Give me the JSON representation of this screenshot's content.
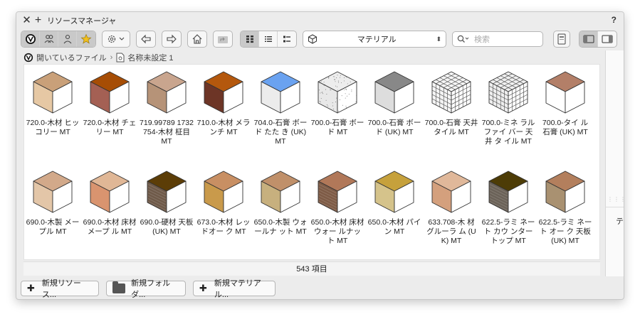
{
  "window": {
    "title": "リソースマネージャ",
    "help": "?"
  },
  "toolbar": {
    "resource_type": "マテリアル",
    "search_placeholder": "検索"
  },
  "path": {
    "root": "開いているファイル",
    "file": "名称未設定 1"
  },
  "items": [
    {
      "label": "720.0-木材 ヒッコリー MT",
      "top": "#c9a079",
      "left": "#e6c8a4",
      "right": "#ffffff",
      "pattern": "none"
    },
    {
      "label": "720.0-木材 チェリー MT",
      "top": "#a64d05",
      "left": "#a46054",
      "right": "#ffffff",
      "pattern": "none"
    },
    {
      "label": "719.99789 1732754-木材 柾目 MT",
      "top": "#c9a58e",
      "left": "#b69378",
      "right": "#ffffff",
      "pattern": "none"
    },
    {
      "label": "710.0-木材 メランチ MT",
      "top": "#b4580d",
      "left": "#6d3526",
      "right": "#ffffff",
      "pattern": "none"
    },
    {
      "label": "704.0-石膏 ボード たた き (UK) MT",
      "top": "#6aa2f0",
      "left": "#ececec",
      "right": "#ffffff",
      "pattern": "none"
    },
    {
      "label": "700.0-石膏 ボード MT",
      "top": "#ededed",
      "left": "#e8e8e8",
      "right": "#ffffff",
      "pattern": "speckle"
    },
    {
      "label": "700.0-石膏 ボード (UK) MT",
      "top": "#888888",
      "left": "#dddddd",
      "right": "#ffffff",
      "pattern": "none"
    },
    {
      "label": "700.0-石膏 天井 タイル MT",
      "top": "#f5f5f5",
      "left": "#f5f5f5",
      "right": "#ffffff",
      "pattern": "grid"
    },
    {
      "label": "700.0-ミネ ラル ファイ バー 天井 タ イル MT",
      "top": "#f0f0f0",
      "left": "#eeeeee",
      "right": "#ffffff",
      "pattern": "grid"
    },
    {
      "label": "700.0-タイ ル 石膏 (UK) MT",
      "top": "#b37f68",
      "left": "#ffffff",
      "right": "#ffffff",
      "pattern": "none"
    },
    {
      "label": "690.0-木製 メープル MT",
      "top": "#d2a98a",
      "left": "#e3c6a8",
      "right": "#ffffff",
      "pattern": "none"
    },
    {
      "label": "690.0-木材 床材 メープ ル MT",
      "top": "#e0b796",
      "left": "#d9946f",
      "right": "#ffffff",
      "pattern": "none"
    },
    {
      "label": "690.0-硬材 天板 (UK) MT",
      "top": "#5c3d07",
      "left": "#6f5a49",
      "right": "#ffffff",
      "pattern": "wood"
    },
    {
      "label": "673.0-木材 レッドオー ク MT",
      "top": "#c88f63",
      "left": "#c99a4b",
      "right": "#ffffff",
      "pattern": "none"
    },
    {
      "label": "650.0-木製 ウォールナ ット MT",
      "top": "#c0906a",
      "left": "#c7b07e",
      "right": "#ffffff",
      "pattern": "none"
    },
    {
      "label": "650.0-木材 床材 ウォー ルナット MT",
      "top": "#b17859",
      "left": "#7e5b46",
      "right": "#ffffff",
      "pattern": "wood"
    },
    {
      "label": "650.0-木材 パイン MT",
      "top": "#c6a13c",
      "left": "#d5c38b",
      "right": "#ffffff",
      "pattern": "none"
    },
    {
      "label": "633.708-木 材 グルーラ ム (UK) MT",
      "top": "#e0b89a",
      "left": "#d4a07d",
      "right": "#ffffff",
      "pattern": "none"
    },
    {
      "label": "622.5-ラミ ネート カウ ンタートップ MT",
      "top": "#4d3c06",
      "left": "#6b6258",
      "right": "#ffffff",
      "pattern": "wood"
    },
    {
      "label": "622.5-ラミ ネート オー ク 天板 (UK) MT",
      "top": "#b37f5d",
      "left": "#a99171",
      "right": "#ffffff",
      "pattern": "none"
    }
  ],
  "status": {
    "count": "543 項目"
  },
  "side_panel": {
    "text": "テ"
  },
  "bottom": {
    "new_resource": "新規リソース...",
    "new_folder": "新規フォルダ...",
    "new_material": "新規マテリアル..."
  }
}
